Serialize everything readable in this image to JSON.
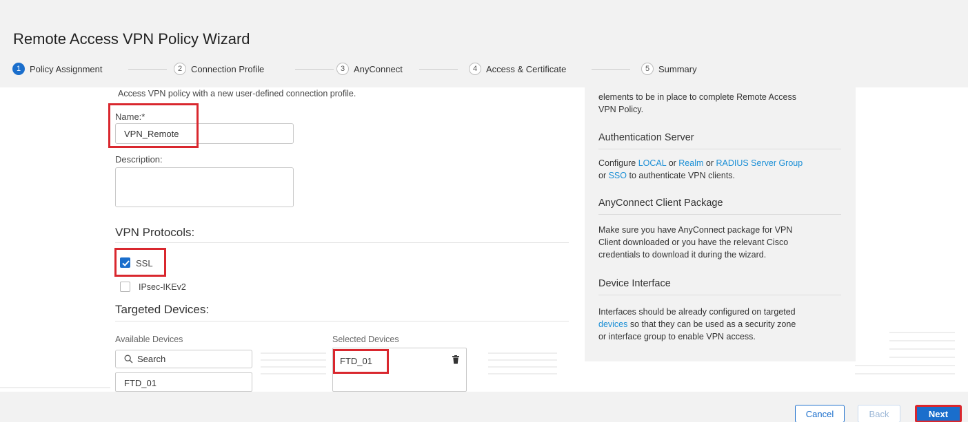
{
  "wizard": {
    "title": "Remote Access VPN Policy Wizard",
    "steps": [
      {
        "number": "1",
        "label": "Policy Assignment"
      },
      {
        "number": "2",
        "label": "Connection Profile"
      },
      {
        "number": "3",
        "label": "AnyConnect"
      },
      {
        "number": "4",
        "label": "Access & Certificate"
      },
      {
        "number": "5",
        "label": "Summary"
      }
    ]
  },
  "form": {
    "intro_text": "Access VPN policy with a new user-defined connection profile.",
    "name_label": "Name:*",
    "name_value": "VPN_Remote",
    "description_label": "Description:",
    "description_value": "",
    "vpn_protocols_title": "VPN Protocols:",
    "protocols": [
      {
        "label": "SSL",
        "checked": true
      },
      {
        "label": "IPsec-IKEv2",
        "checked": false
      }
    ],
    "targeted_devices_title": "Targeted Devices:",
    "available_devices_label": "Available Devices",
    "search_placeholder": "Search",
    "available_devices": [
      "FTD_01"
    ],
    "selected_devices_label": "Selected Devices",
    "selected_devices": [
      "FTD_01"
    ]
  },
  "side_panel": {
    "intro_line1": "elements to be in place to complete Remote Access",
    "intro_line2": "VPN Policy.",
    "auth_server_title": "Authentication Server",
    "auth_text": {
      "prefix": "Configure ",
      "link_local": "LOCAL",
      "or1": " or ",
      "link_realm": "Realm",
      "or2": " or ",
      "link_radius": "RADIUS Server Group",
      "or3": "or ",
      "link_sso": "SSO",
      "suffix": " to authenticate VPN clients."
    },
    "anyconnect_title": "AnyConnect Client Package",
    "anyconnect_line1": "Make sure you have AnyConnect package for VPN",
    "anyconnect_line2": "Client downloaded or you have the relevant Cisco",
    "anyconnect_line3": "credentials to download it during the wizard.",
    "device_interface_title": "Device Interface",
    "device_line1": "Interfaces should be already configured on targeted",
    "device_link": "devices",
    "device_line2_rest": " so that they can be used as a security zone",
    "device_line3": "or interface group to enable VPN access."
  },
  "footer": {
    "cancel_label": "Cancel",
    "back_label": "Back",
    "next_label": "Next"
  },
  "colors": {
    "accent": "#1a6ecc",
    "link": "#1b8fd6",
    "highlight_box": "#d9272e"
  }
}
